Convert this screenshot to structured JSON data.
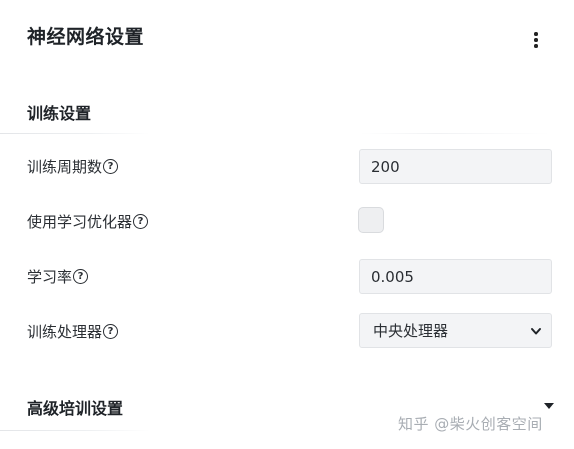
{
  "header": {
    "title": "神经网络设置",
    "menu_icon": "more-vertical-icon"
  },
  "sections": {
    "training": {
      "title": "训练设置",
      "fields": {
        "epochs": {
          "label": "训练周期数",
          "help_icon": "help-circle-icon",
          "value": "200"
        },
        "use_optimizer": {
          "label": "使用学习优化器",
          "help_icon": "help-circle-icon",
          "checked": false
        },
        "learning_rate": {
          "label": "学习率",
          "help_icon": "help-circle-icon",
          "value": "0.005"
        },
        "processor": {
          "label": "训练处理器",
          "help_icon": "help-circle-icon",
          "selected": "中央处理器",
          "chevron_icon": "chevron-down-icon"
        }
      }
    },
    "advanced": {
      "title": "高级培训设置",
      "toggle_icon": "caret-down-icon"
    }
  },
  "watermark": "知乎 @柴火创客空间",
  "colors": {
    "field_bg": "#f3f4f6",
    "field_border": "#e1e3e6",
    "text": "#1f2328",
    "watermark": "#a8adb3"
  }
}
